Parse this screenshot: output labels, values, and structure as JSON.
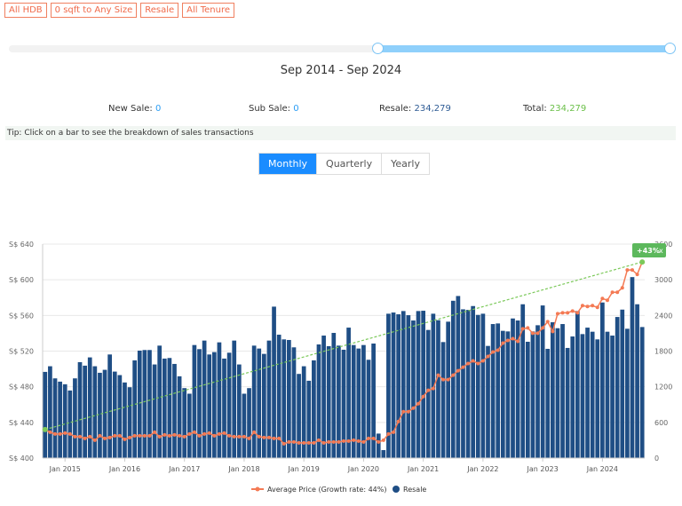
{
  "filters": [
    "All HDB",
    "0 sqft to Any Size",
    "Resale",
    "All Tenure"
  ],
  "range_label": "Sep 2014 - Sep 2024",
  "stats": [
    {
      "label": "New Sale:",
      "value": "0",
      "color": "#2a9df4"
    },
    {
      "label": "Sub Sale:",
      "value": "0",
      "color": "#2a9df4"
    },
    {
      "label": "Resale:",
      "value": "234,279",
      "color": "#2f5c95"
    },
    {
      "label": "Total:",
      "value": "234,279",
      "color": "#6cc04a"
    }
  ],
  "tip": "Tip: Click on a bar to see the breakdown of sales transactions",
  "tabs": [
    {
      "label": "Monthly",
      "active": true
    },
    {
      "label": "Quarterly"
    },
    {
      "label": "Yearly"
    }
  ],
  "chart_data": {
    "type": "bar+line",
    "x_start": "Sep 2014",
    "x_end": "Sep 2024",
    "x_ticks": [
      "Jan 2015",
      "Jan 2016",
      "Jan 2017",
      "Jan 2018",
      "Jan 2019",
      "Jan 2020",
      "Jan 2021",
      "Jan 2022",
      "Jan 2023",
      "Jan 2024"
    ],
    "y_left": {
      "ticks": [
        "S$ 400",
        "S$ 440",
        "S$ 480",
        "S$ 520",
        "S$ 560",
        "S$ 600",
        "S$ 640"
      ],
      "range": [
        400,
        640
      ]
    },
    "y_right": {
      "ticks": [
        "0",
        "600",
        "1200",
        "1800",
        "2400",
        "3000",
        "3600"
      ],
      "range": [
        0,
        3600
      ]
    },
    "grid": true,
    "legend": "bottom",
    "badge": {
      "text": "+43%",
      "close": "x",
      "color": "#5cb85c"
    },
    "series": [
      {
        "name": "Average Price (Growth rate: 44%)",
        "type": "line",
        "axis": "left",
        "color": "#f47a54",
        "values": [
          432,
          429,
          427,
          427,
          428,
          427,
          424,
          424,
          422,
          424,
          420,
          425,
          422,
          423,
          425,
          425,
          421,
          423,
          425,
          425,
          425,
          425,
          429,
          424,
          426,
          425,
          426,
          425,
          424,
          427,
          429,
          425,
          427,
          428,
          425,
          427,
          428,
          425,
          424,
          424,
          424,
          422,
          429,
          424,
          423,
          423,
          422,
          422,
          416,
          418,
          418,
          417,
          417,
          417,
          417,
          420,
          417,
          418,
          418,
          418,
          419,
          419,
          420,
          419,
          418,
          422,
          422,
          418,
          420,
          427,
          429,
          441,
          452,
          452,
          456,
          461,
          469,
          476,
          478,
          493,
          488,
          488,
          493,
          498,
          502,
          506,
          509,
          506,
          509,
          514,
          519,
          521,
          529,
          532,
          534,
          531,
          545,
          546,
          540,
          540,
          546,
          553,
          542,
          562,
          563,
          563,
          565,
          563,
          571,
          570,
          571,
          569,
          579,
          577,
          586,
          586,
          591,
          611,
          611,
          606,
          620
        ]
      },
      {
        "name": "Resale",
        "type": "bar",
        "axis": "right",
        "color": "#1f4e85",
        "values": [
          1450,
          1545,
          1341,
          1286,
          1242,
          1137,
          1341,
          1614,
          1555,
          1694,
          1545,
          1435,
          1485,
          1743,
          1455,
          1396,
          1272,
          1192,
          1644,
          1808,
          1818,
          1818,
          1575,
          1892,
          1674,
          1684,
          1584,
          1376,
          1177,
          1083,
          1902,
          1833,
          1977,
          1743,
          1783,
          1947,
          1674,
          1773,
          1977,
          1575,
          1083,
          1177,
          1892,
          1843,
          1753,
          1977,
          2548,
          2076,
          1997,
          1987,
          1863,
          1416,
          1545,
          1301,
          1644,
          1912,
          2061,
          1883,
          2106,
          1892,
          1823,
          2195,
          1902,
          1843,
          1902,
          1654,
          1927,
          412,
          134,
          2429,
          2449,
          2419,
          2474,
          2404,
          2315,
          2474,
          2479,
          2156,
          2429,
          2320,
          1952,
          2295,
          2647,
          2727,
          2503,
          2493,
          2558,
          2409,
          2429,
          1887,
          2255,
          2265,
          2141,
          2131,
          2349,
          2315,
          2588,
          1957,
          2131,
          2235,
          2568,
          1838,
          2285,
          2185,
          2255,
          1853,
          2046,
          2474,
          2086,
          2195,
          2126,
          1997,
          2618,
          2126,
          2061,
          2374,
          2498,
          2176,
          3045,
          2588,
          2205
        ]
      }
    ],
    "trendline": {
      "color": "#7cc95a",
      "from": 432,
      "to": 620
    }
  }
}
